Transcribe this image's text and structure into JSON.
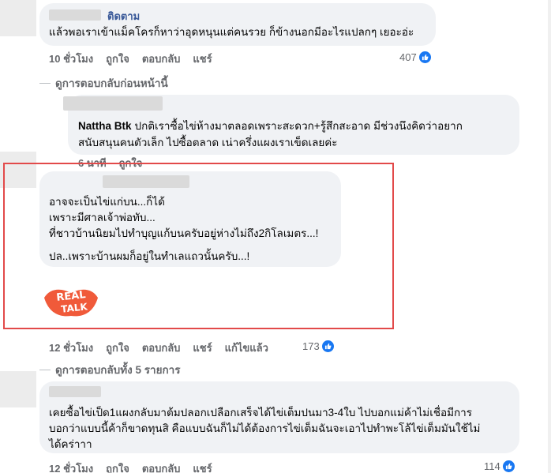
{
  "colors": {
    "link": "#385898",
    "meta": "#65676b",
    "like": "#1877f2",
    "highlight": "#e24a4a",
    "logo": "#f05a3a"
  },
  "comments": [
    {
      "follow": "ติดตาม",
      "lines": [
        "แล้วพอเราเข้าแม็คโครก็หาว่าอุดหนุนแต่คนรวย ก็ข้างนอกมีอะไรแปลกๆ เยอะอ่ะ"
      ],
      "meta": [
        "10 ชั่วโมง",
        "ถูกใจ",
        "ตอบกลับ",
        "แชร์"
      ],
      "likes": "407"
    },
    {
      "name": "Nattha Btk",
      "lines": [
        "ปกติเราซื้อไข่ห้างมาตลอดเพราะสะดวก+รู้สึกสะอาด มีช่วงนึงคิดว่าอยาก",
        "สนับสนุนคนตัวเล็ก ไปซื้อตลาด เน่าครึ่งแผงเราเข็ดเลยค่ะ"
      ],
      "meta": [
        "6 นาที",
        "ถูกใจ"
      ]
    },
    {
      "lines": [
        "อาจจะเป็นไข่แก่บน...ก็ได้",
        "เพราะมีศาลเจ้าพ่อทับ...",
        "ที่ชาวบ้านนิยมไปทำบุญแก้บนครับอยู่ห่างไม่ถึง2กิโลเมตร...!",
        "ปล..เพราะบ้านผมก็อยู่ในทำเลแถวนั้นครับ...!"
      ],
      "logo_top": "REAL",
      "logo_bottom": "TALK",
      "meta": [
        "12 ชั่วโมง",
        "ถูกใจ",
        "ตอบกลับ",
        "แชร์",
        "แก้ไขแล้ว"
      ],
      "likes": "173"
    },
    {
      "lines": [
        "เคยซื้อไข่เป็ด1แผงกลับมาต้มปลอกเปลือกเสร็จได้ไข่เต็มปนมา3-4ใบ ไปบอกแม่ค้าไม่เชื่อมีการ",
        "บอกว่าแบบนี้ค้าก็ขาดทุนสิ คือแบบฉันก็ไม่ได้ต้องการไข่เต็มฉันจะเอาไปทำพะโล้ไข่เต็มมันใช้ไม่",
        "ได้คร่าาา"
      ],
      "meta": [
        "12 ชั่วโมง",
        "ถูกใจ",
        "ตอบกลับ",
        "แชร์"
      ],
      "likes": "114"
    }
  ],
  "see_previous": "ดูการตอบกลับก่อนหน้านี้",
  "see_all": "ดูการตอบกลับทั้ง 5 รายการ"
}
